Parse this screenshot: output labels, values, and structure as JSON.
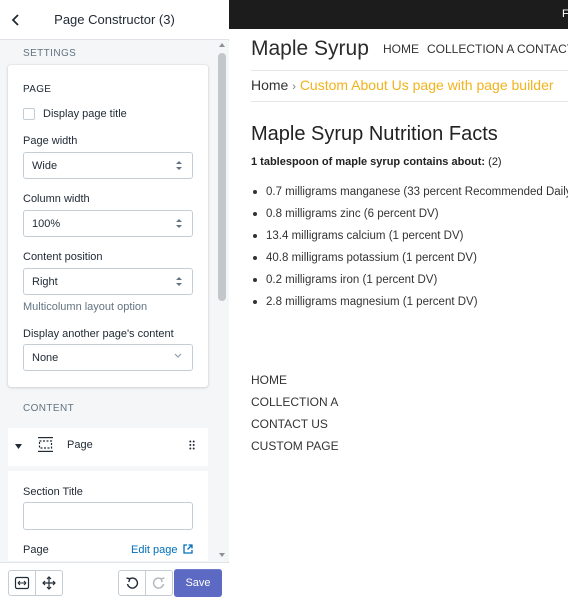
{
  "panel": {
    "title": "Page Constructor (3)",
    "settings_label": "SETTINGS",
    "page_card": {
      "title": "PAGE",
      "display_title_label": "Display page title",
      "display_title_checked": false,
      "page_width_label": "Page width",
      "page_width_value": "Wide",
      "column_width_label": "Column width",
      "column_width_value": "100%",
      "content_position_label": "Content position",
      "content_position_value": "Right",
      "multicolumn_hint": "Multicolumn layout option",
      "display_another_label": "Display another page's content",
      "display_another_value": "None"
    },
    "content_label": "CONTENT",
    "content_block": {
      "name": "Page",
      "section_title_label": "Section Title",
      "section_title_value": "",
      "page_label": "Page",
      "edit_page_link": "Edit page"
    },
    "footer": {
      "save_label": "Save"
    }
  },
  "preview": {
    "topbar_text": "F",
    "store_name": "Maple Syrup",
    "nav": [
      "HOME",
      "COLLECTION A",
      "CONTACT"
    ],
    "breadcrumb": {
      "home": "Home",
      "separator": "›",
      "current": "Custom About Us page with page builder"
    },
    "heading": "Maple Syrup Nutrition Facts",
    "intro_bold": "1 tablespoon of maple syrup contains about:",
    "intro_rest": " (2)",
    "facts": [
      "0.7 milligrams manganese (33 percent Recommended Daily",
      "0.8 milligrams zinc (6 percent DV)",
      "13.4 milligrams calcium (1 percent DV)",
      "40.8 milligrams potassium (1 percent DV)",
      "0.2 milligrams iron (1 percent DV)",
      "2.8 milligrams magnesium (1 percent DV)"
    ],
    "footer_links": [
      "HOME",
      "COLLECTION A",
      "CONTACT US",
      "CUSTOM PAGE"
    ]
  },
  "colors": {
    "accent": "#5c6ac4",
    "breadcrumb_current": "#f2b21b",
    "topbar": "#1c1c1c"
  }
}
